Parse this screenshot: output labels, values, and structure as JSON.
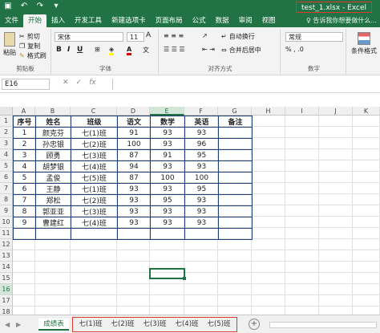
{
  "title": "test_1.xlsx - Excel",
  "colors": {
    "accent": "#217346",
    "highlight": "#e03a2f",
    "table_border": "#1f3d7a"
  },
  "qat_icons": [
    "save-icon",
    "undo-icon",
    "redo-icon",
    "customize-icon"
  ],
  "tabs": [
    "文件",
    "开始",
    "插入",
    "开发工具",
    "新建选项卡",
    "页面布局",
    "公式",
    "数据",
    "审阅",
    "视图"
  ],
  "active_tab": "开始",
  "tell_me": "告诉我你想要做什么...",
  "ribbon": {
    "clipboard": {
      "paste": "粘贴",
      "cut": "剪切",
      "copy": "复制",
      "format_painter": "格式刷",
      "label": "剪贴板"
    },
    "font": {
      "name": "宋体",
      "size": "11",
      "label": "字体",
      "bold": "B",
      "italic": "I",
      "underline": "U"
    },
    "alignment": {
      "wrap": "自动换行",
      "merge": "合并后居中",
      "label": "对齐方式"
    },
    "number": {
      "format": "常规",
      "label": "数字"
    },
    "styles": {
      "conditional": "条件格式"
    }
  },
  "formula_bar": {
    "name_box": "E16",
    "value": ""
  },
  "columns": [
    "A",
    "B",
    "C",
    "D",
    "E",
    "F",
    "G",
    "H",
    "I",
    "J",
    "K"
  ],
  "rows": [
    "1",
    "2",
    "3",
    "4",
    "5",
    "6",
    "7",
    "8",
    "9",
    "10",
    "11",
    "12",
    "13",
    "14",
    "15",
    "16",
    "17",
    "18"
  ],
  "selected_column": "E",
  "selected_row": "16",
  "table": {
    "headers": [
      "序号",
      "姓名",
      "班级",
      "语文",
      "数学",
      "英语",
      "备注"
    ],
    "rows": [
      [
        "1",
        "颜克芬",
        "七(1)班",
        "91",
        "93",
        "93",
        ""
      ],
      [
        "2",
        "孙忠银",
        "七(2)班",
        "100",
        "93",
        "96",
        ""
      ],
      [
        "3",
        "顾勇",
        "七(3)班",
        "87",
        "91",
        "95",
        ""
      ],
      [
        "4",
        "胡梦银",
        "七(4)班",
        "94",
        "93",
        "93",
        ""
      ],
      [
        "5",
        "孟俊",
        "七(5)班",
        "87",
        "100",
        "100",
        ""
      ],
      [
        "6",
        "王静",
        "七(1)班",
        "93",
        "93",
        "95",
        ""
      ],
      [
        "7",
        "郑松",
        "七(2)班",
        "93",
        "95",
        "93",
        ""
      ],
      [
        "8",
        "郭亚亚",
        "七(3)班",
        "93",
        "93",
        "93",
        ""
      ],
      [
        "9",
        "曹建红",
        "七(4)班",
        "93",
        "93",
        "93",
        ""
      ],
      [
        "",
        "",
        "",
        "",
        "",
        "",
        ""
      ]
    ]
  },
  "sheets": [
    "成绩表",
    "七(1)班",
    "七(2)班",
    "七(3)班",
    "七(4)班",
    "七(5)班"
  ],
  "active_sheet": "成绩表"
}
